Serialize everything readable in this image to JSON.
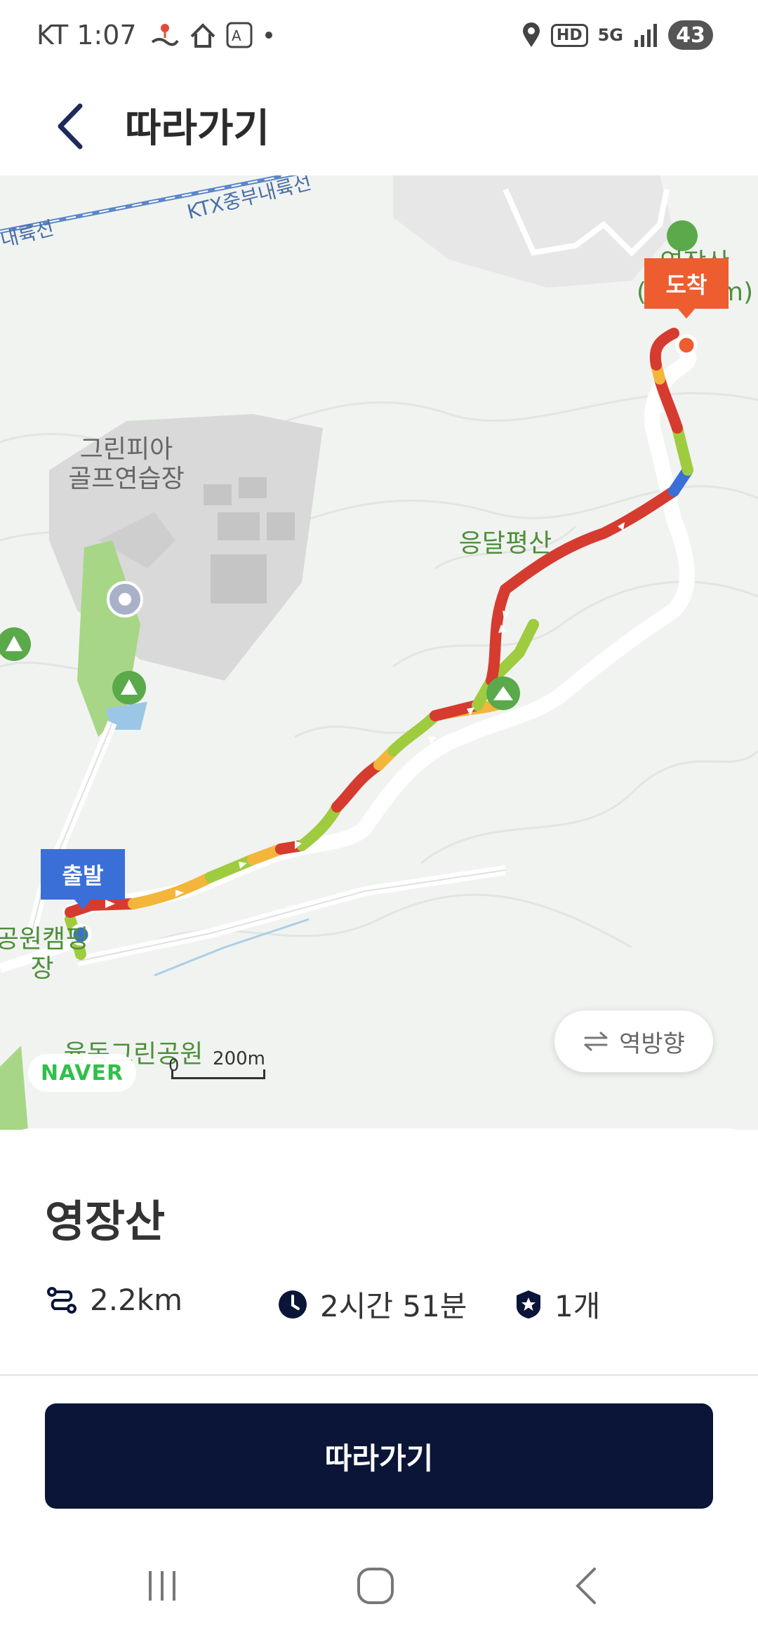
{
  "status_bar": {
    "carrier_time": "KT 1:07",
    "battery": "43",
    "hd": "HD",
    "network": "5G"
  },
  "header": {
    "title": "따라가기"
  },
  "map": {
    "rail_label": "KTX중부내륙선",
    "rail_label_left": "내륙선",
    "peak_label": "영장산\n(414.1m)",
    "poi_golf": "그린피아\n골프연습장",
    "poi_mountain": "응달평산",
    "poi_camp": "공원캠핑장",
    "poi_park": "율동그린공원",
    "start_pin": "출발",
    "end_pin": "도착",
    "logo": "NAVER",
    "scale_label": "200m",
    "scale_zero": "0",
    "reverse_button": "역방향"
  },
  "course": {
    "name": "영장산",
    "distance": "2.2km",
    "duration": "2시간 51분",
    "count": "1개"
  },
  "follow_button": "따라가기",
  "colors": {
    "primary": "#0b1538",
    "start_pin": "#3b6fd8",
    "end_pin": "#ee5d2f",
    "route_red": "#d63b2f",
    "route_yellow": "#f3b63a",
    "route_green": "#9fcb3f",
    "route_blue": "#3b6fd8"
  }
}
